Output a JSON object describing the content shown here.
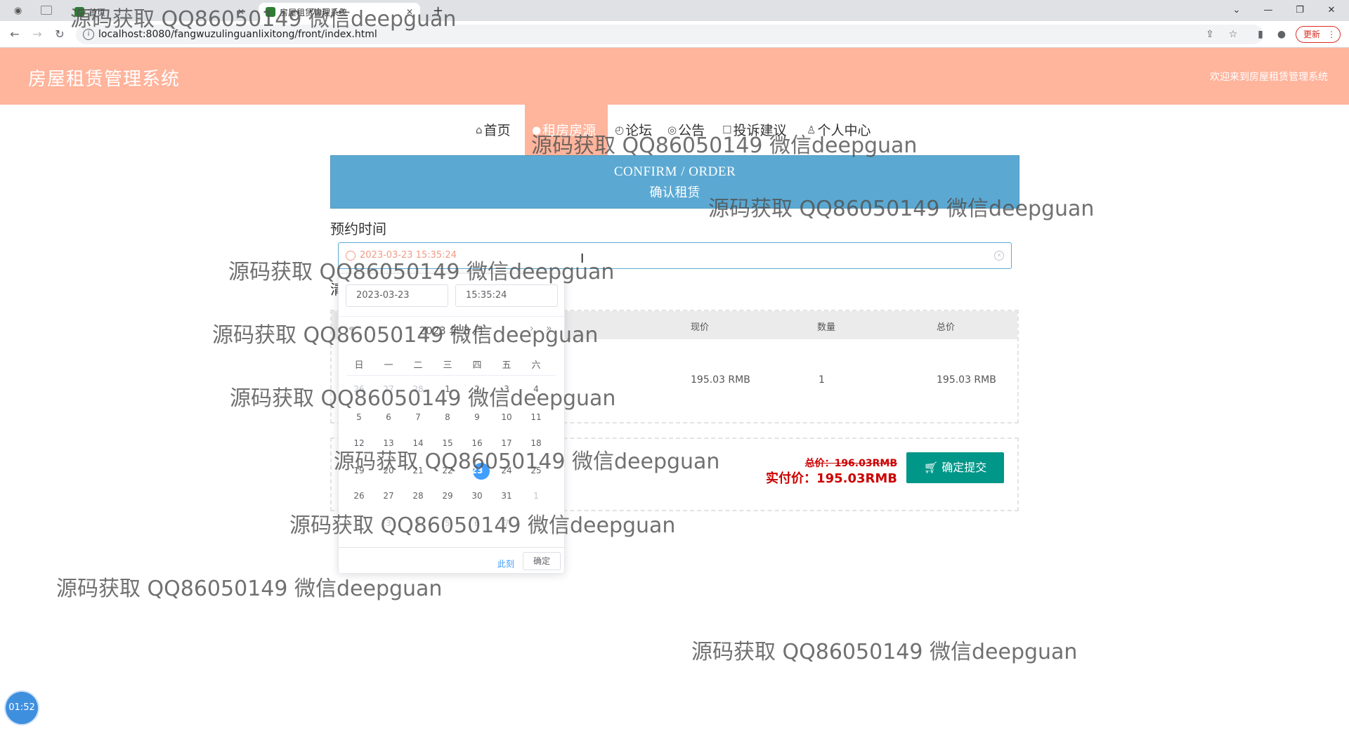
{
  "browser": {
    "tabs": [
      {
        "label": "首页"
      },
      {
        "label": "房屋租赁管理系统"
      }
    ],
    "url": "localhost:8080/fangwuzulinguanlixitong/front/index.html",
    "update_label": "更新"
  },
  "site": {
    "title": "房屋租赁管理系统",
    "welcome": "欢迎来到房屋租赁管理系统"
  },
  "nav": {
    "items": [
      {
        "label": "首页"
      },
      {
        "label": "租房房源"
      },
      {
        "label": "论坛"
      },
      {
        "label": "公告"
      },
      {
        "label": "投诉建议"
      },
      {
        "label": "个人中心"
      }
    ]
  },
  "banner": {
    "en": "CONFIRM / ORDER",
    "zh": "确认租赁"
  },
  "form": {
    "time_label": "预约时间",
    "time_value": "2023-03-23 15:35:24",
    "hidden_label": "清"
  },
  "order": {
    "headers": {
      "price": "现价",
      "qty": "数量",
      "total": "总价"
    },
    "row": {
      "price": "195.03 RMB",
      "qty": "1",
      "total": "195.03 RMB"
    }
  },
  "summary": {
    "total_old": "总价：196.03RMB",
    "total_real": "实付价：195.03RMB",
    "submit_label": "确定提交"
  },
  "picker": {
    "date": "2023-03-23",
    "time": "15:35:24",
    "month_label": "2023 年 3 月",
    "weekdays": [
      "日",
      "一",
      "二",
      "三",
      "四",
      "五",
      "六"
    ],
    "now_label": "此刻",
    "ok_label": "确定",
    "weeks": [
      [
        "26",
        "27",
        "28",
        "1",
        "2",
        "3",
        "4"
      ],
      [
        "5",
        "6",
        "7",
        "8",
        "9",
        "10",
        "11"
      ],
      [
        "12",
        "13",
        "14",
        "15",
        "16",
        "17",
        "18"
      ],
      [
        "19",
        "20",
        "21",
        "22",
        "23",
        "24",
        "25"
      ],
      [
        "26",
        "27",
        "28",
        "29",
        "30",
        "31",
        "1"
      ],
      [
        "2",
        "3",
        "4",
        "5",
        "6",
        "7",
        "8"
      ]
    ],
    "selected": "23"
  },
  "watermark": "源码获取 QQ86050149 微信deepguan",
  "timer": "01:52",
  "colors": {
    "header": "#ffb49c",
    "banner": "#5ba9d3",
    "submit": "#009688",
    "price_red": "#cc0000"
  }
}
